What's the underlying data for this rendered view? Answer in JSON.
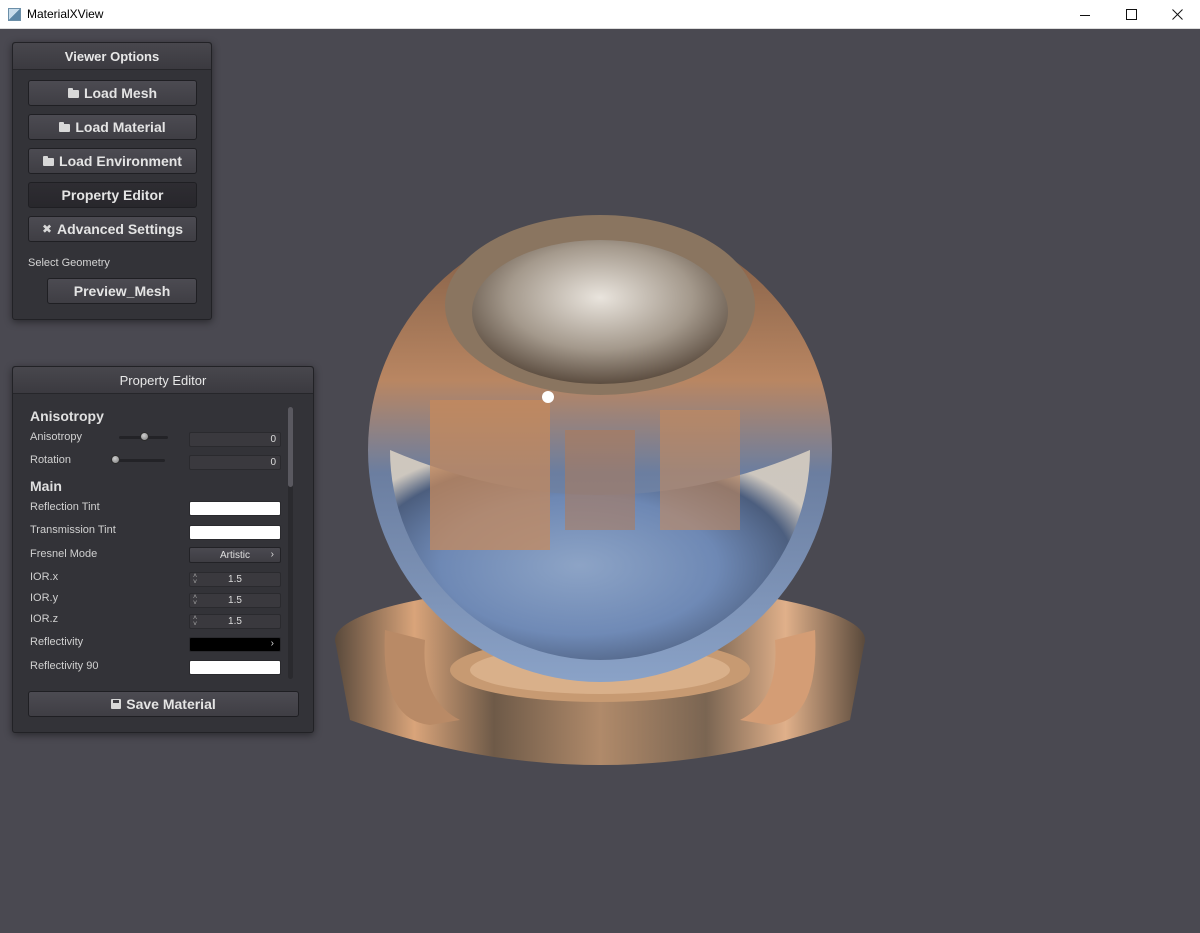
{
  "window": {
    "title": "MaterialXView",
    "minimize_label": "minimize",
    "maximize_label": "maximize",
    "close_label": "close"
  },
  "viewer_options": {
    "title": "Viewer Options",
    "load_mesh": "Load Mesh",
    "load_material": "Load Material",
    "load_environment": "Load Environment",
    "property_editor": "Property Editor",
    "advanced_settings": "Advanced Settings",
    "select_geometry_label": "Select Geometry",
    "geometry_selected": "Preview_Mesh"
  },
  "property_editor": {
    "title": "Property Editor",
    "sections": {
      "anisotropy": "Anisotropy",
      "main": "Main"
    },
    "anisotropy": {
      "label": "Anisotropy",
      "value": "0",
      "slider_level": 0.5
    },
    "rotation": {
      "label": "Rotation",
      "value": "0",
      "slider_level": 0.0
    },
    "reflection_tint": {
      "label": "Reflection Tint",
      "color": "#ffffff"
    },
    "transmission_tint": {
      "label": "Transmission Tint",
      "color": "#ffffff"
    },
    "fresnel_mode": {
      "label": "Fresnel Mode",
      "value": "Artistic"
    },
    "ior_x": {
      "label": "IOR.x",
      "value": "1.5"
    },
    "ior_y": {
      "label": "IOR.y",
      "value": "1.5"
    },
    "ior_z": {
      "label": "IOR.z",
      "value": "1.5"
    },
    "reflectivity": {
      "label": "Reflectivity",
      "color": "#000000"
    },
    "reflectivity_90": {
      "label": "Reflectivity 90",
      "color": "#ffffff"
    },
    "save_material": "Save Material"
  },
  "colors": {
    "viewport_background": "#4a4951",
    "panel_background": "#333338"
  },
  "icons": {
    "folder": "folder-icon",
    "tools": "tools-icon",
    "save": "save-icon"
  }
}
